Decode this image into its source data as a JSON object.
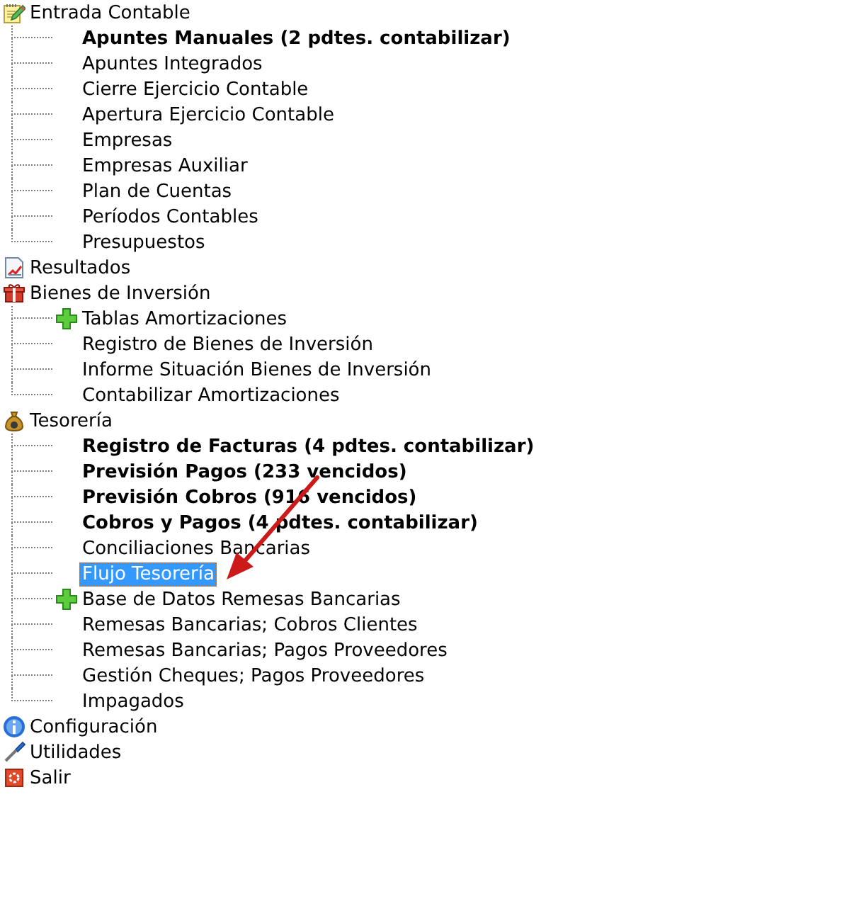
{
  "tree": {
    "sections": [
      {
        "label": "Entrada Contable",
        "selected": false,
        "children": [
          {
            "label": "Apuntes Manuales (2 pdtes. contabilizar)",
            "bold": true,
            "selected": false,
            "kind": "leaf"
          },
          {
            "label": "Apuntes Integrados",
            "bold": false,
            "selected": false,
            "kind": "leaf"
          },
          {
            "label": "Cierre Ejercicio Contable",
            "bold": false,
            "selected": false,
            "kind": "leaf"
          },
          {
            "label": "Apertura Ejercicio Contable",
            "bold": false,
            "selected": false,
            "kind": "leaf"
          },
          {
            "label": "Empresas",
            "bold": false,
            "selected": false,
            "kind": "leaf"
          },
          {
            "label": "Empresas Auxiliar",
            "bold": false,
            "selected": false,
            "kind": "leaf"
          },
          {
            "label": "Plan de Cuentas",
            "bold": false,
            "selected": false,
            "kind": "leaf"
          },
          {
            "label": "Períodos Contables",
            "bold": false,
            "selected": false,
            "kind": "leaf"
          },
          {
            "label": "Presupuestos",
            "bold": false,
            "selected": false,
            "kind": "leaf"
          }
        ]
      },
      {
        "label": "Resultados",
        "selected": false
      },
      {
        "label": "Bienes de Inversión",
        "selected": false,
        "children": [
          {
            "label": "Tablas Amortizaciones",
            "bold": false,
            "selected": false,
            "kind": "folder"
          },
          {
            "label": "Registro de Bienes de Inversión",
            "bold": false,
            "selected": false,
            "kind": "leaf"
          },
          {
            "label": "Informe Situación Bienes de Inversión",
            "bold": false,
            "selected": false,
            "kind": "leaf"
          },
          {
            "label": "Contabilizar Amortizaciones",
            "bold": false,
            "selected": false,
            "kind": "leaf"
          }
        ]
      },
      {
        "label": "Tesorería",
        "selected": false,
        "children": [
          {
            "label": "Registro de Facturas (4 pdtes. contabilizar)",
            "bold": true,
            "selected": false,
            "kind": "leaf"
          },
          {
            "label": "Previsión Pagos (233 vencidos)",
            "bold": true,
            "selected": false,
            "kind": "leaf"
          },
          {
            "label": "Previsión Cobros (916 vencidos)",
            "bold": true,
            "selected": false,
            "kind": "leaf"
          },
          {
            "label": "Cobros y Pagos (4 pdtes. contabilizar)",
            "bold": true,
            "selected": false,
            "kind": "leaf"
          },
          {
            "label": "Conciliaciones Bancarias",
            "bold": false,
            "selected": false,
            "kind": "leaf"
          },
          {
            "label": "Flujo Tesorería",
            "bold": false,
            "selected": true,
            "kind": "leaf"
          },
          {
            "label": "Base de Datos Remesas Bancarias",
            "bold": false,
            "selected": false,
            "kind": "folder"
          },
          {
            "label": "Remesas Bancarias; Cobros Clientes",
            "bold": false,
            "selected": false,
            "kind": "leaf"
          },
          {
            "label": "Remesas Bancarias; Pagos Proveedores",
            "bold": false,
            "selected": false,
            "kind": "leaf"
          },
          {
            "label": "Gestión Cheques; Pagos Proveedores",
            "bold": false,
            "selected": false,
            "kind": "leaf"
          },
          {
            "label": "Impagados",
            "bold": false,
            "selected": false,
            "kind": "leaf"
          }
        ]
      },
      {
        "label": "Configuración",
        "selected": false
      },
      {
        "label": "Utilidades",
        "selected": false
      },
      {
        "label": "Salir",
        "selected": false
      }
    ]
  }
}
